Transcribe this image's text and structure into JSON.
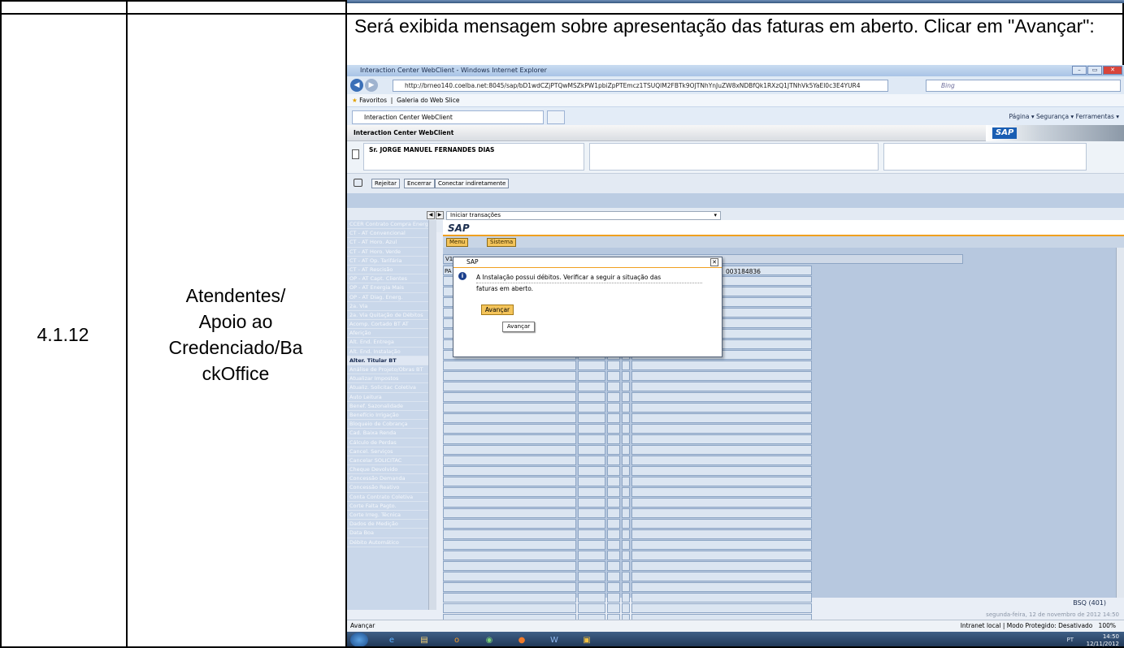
{
  "row": {
    "step": "4.1.12",
    "role": "Atendentes/ Apoio ao Credenciado/Ba ckOffice",
    "role_lines": [
      "Atendentes/",
      "Apoio ao",
      "Credenciado/Ba",
      "ckOffice"
    ],
    "description": "Será exibida mensagem sobre apresentação das faturas em aberto. Clicar em \"Avançar\":"
  },
  "browser": {
    "window_title": "Interaction Center WebClient - Windows Internet Explorer",
    "address": "http://brneo140.coelba.net:8045/sap/bD1wdCZjPTQwMSZkPW1pbiZpPTEmcz1TSUQlM2FBTk9OJTNhYnJuZW8xNDBfQk1RXzQ1JTNhVk5YaEl0c3E4YUR4",
    "search_placeholder": "Bing",
    "favorites_label": "Favoritos",
    "gallery_label": "Galeria do Web Slice",
    "tab_label": "Interaction Center WebClient",
    "tools_label": "Página ▾  Segurança ▾  Ferramentas ▾",
    "status_left": "Avançar",
    "status_zone": "Intranet local | Modo Protegido: Desativado",
    "zoom": "100%"
  },
  "app": {
    "header_title": "Interaction Center WebClient",
    "logo": "SAP",
    "customer_name": "Sr. JORGE MANUEL FERNANDES DIAS",
    "buttons": [
      "Rejeitar",
      "Encerrar",
      "Conectar indiretamente"
    ],
    "transactions_select": "Iniciar transações",
    "sap_title": "SAP",
    "menu_label": "Menu",
    "system_label": "Sistema",
    "side_items": [
      "CCER Contrato Compra Energia",
      "CT - AT Convencional",
      "CT - AT Horo. Azul",
      "CT - AT Horo. Verde",
      "CT - AT Op. Tarifária",
      "CT - AT Rescisão",
      "OP - AT Capt. Clientes",
      "OP - AT Energia Mais",
      "OP - AT Diag. Energ.",
      "2a. Via",
      "2a. Via Quitação de Débitos",
      "Acomp. Cortado BT AT",
      "Aferição",
      "Alt. End. Entrega",
      "Alt. End. Instalação",
      "Alter. Titular BT",
      "Análise de Projeto/Obras BT",
      "Atualizar Impostos",
      "Atualiz. Solicitac Coletiva",
      "Auto Leitura",
      "Benef. Sazonalidade",
      "Benefício Irrigação",
      "Bloqueio de Cobrança",
      "Cad. Baixa Renda",
      "Cálculo de Perdas",
      "Cancel. Serviços",
      "Cancelar SOLICITAC",
      "Cheque Devolvido",
      "Concessão Demanda",
      "Concessão Reativo",
      "Conta Contrato Coletiva",
      "Corte Falta Pagto.",
      "Corte Irreg. Técnica",
      "Dados de Medição",
      "Data Boa",
      "Débito Automático"
    ],
    "selected_item": "Alter. Titular BT",
    "grid_label_v": "V1",
    "grid_label_pa": "PA",
    "installation_no": "003184836",
    "bsq": "BSQ (401)",
    "status_date": "segunda-feira, 12 de novembro de 2012 14:50"
  },
  "dialog": {
    "title": "SAP",
    "message_line1": "A Instalação possui débitos. Verificar a seguir a situação das",
    "message_line2": "faturas em aberto.",
    "button": "Avançar",
    "tooltip": "Avançar"
  },
  "taskbar": {
    "lang": "PT",
    "time": "14:50",
    "date": "12/11/2012"
  }
}
